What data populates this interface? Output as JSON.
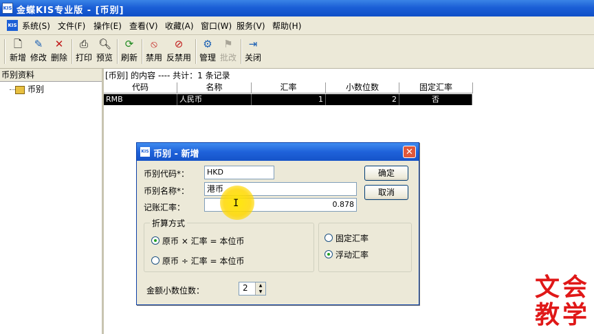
{
  "window": {
    "title": "金蝶KIS专业版 - [币别]",
    "icon_text": "KIS"
  },
  "menu": [
    {
      "label": "系统(S)"
    },
    {
      "label": "文件(F)"
    },
    {
      "label": "操作(E)"
    },
    {
      "label": "查看(V)"
    },
    {
      "label": "收藏(A)"
    },
    {
      "label": "窗口(W)"
    },
    {
      "label": "服务(V)"
    },
    {
      "label": "帮助(H)"
    }
  ],
  "toolbar": {
    "new": "新增",
    "edit": "修改",
    "delete": "删除",
    "print": "打印",
    "preview": "预览",
    "refresh": "刷新",
    "disable": "禁用",
    "enable": "反禁用",
    "manage": "管理",
    "approve": "批改",
    "close": "关闭"
  },
  "left_panel": {
    "header": "币别资料",
    "tree_item": "币别"
  },
  "grid": {
    "header_text": "[币别] 的内容 ---- 共计：1 条记录",
    "columns": [
      "代码",
      "名称",
      "汇率",
      "小数位数",
      "固定汇率"
    ],
    "rows": [
      {
        "code": "RMB",
        "name": "人民币",
        "rate": "1",
        "decimals": "2",
        "fixed": "否"
      }
    ]
  },
  "dialog": {
    "title": "币别 - 新增",
    "code_label": "币别代码*：",
    "code_value": "HKD",
    "name_label": "币别名称*：",
    "name_value": "港币",
    "rate_label": "记账汇率：",
    "rate_value": "0.878",
    "ok": "确定",
    "cancel": "取消",
    "conversion_group": "折算方式",
    "conv_multiply": "原币 × 汇率 = 本位币",
    "conv_divide": "原币 ÷ 汇率 = 本位币",
    "fixed_rate": "固定汇率",
    "floating_rate": "浮动汇率",
    "decimals_label": "金额小数位数：",
    "decimals_value": "2"
  },
  "watermark": {
    "line1": "文会",
    "line2": "教学"
  }
}
